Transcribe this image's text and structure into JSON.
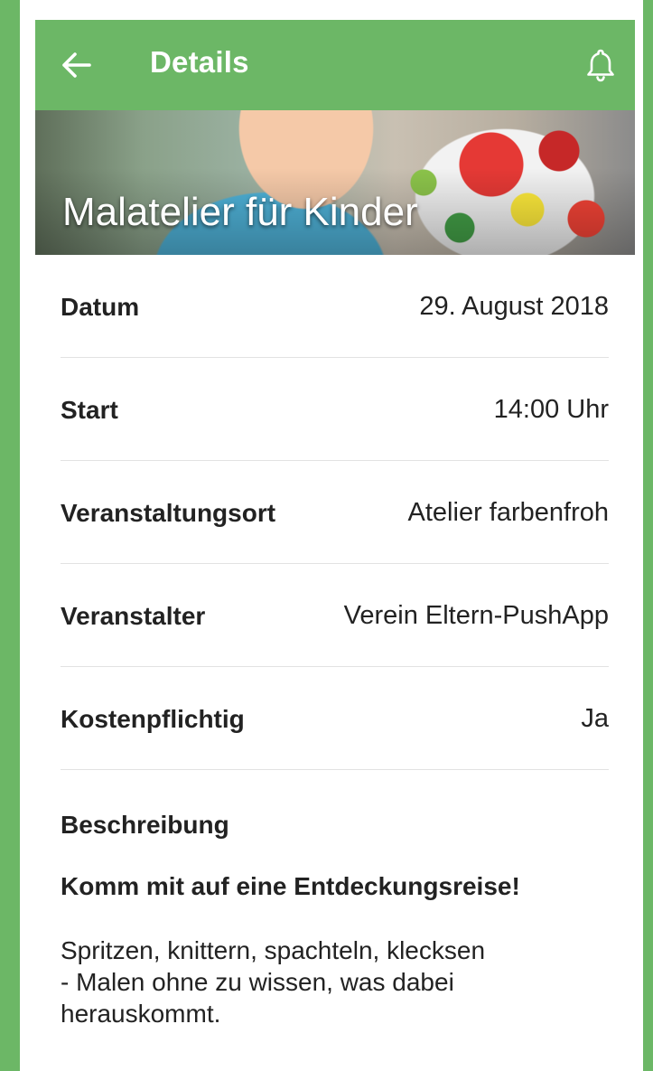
{
  "colors": {
    "accent": "#6cb766",
    "background": "#ffffff",
    "text": "#222222"
  },
  "appbar": {
    "title": "Details",
    "back_icon": "arrow-left-icon",
    "notification_icon": "bell-icon"
  },
  "event": {
    "title": "Malatelier für Kinder"
  },
  "details": [
    {
      "label": "Datum",
      "value": "29. August 2018"
    },
    {
      "label": "Start",
      "value": "14:00 Uhr"
    },
    {
      "label": "Veranstaltungsort",
      "value": "Atelier farbenfroh"
    },
    {
      "label": "Veranstalter",
      "value": "Verein Eltern-PushApp"
    },
    {
      "label": "Kostenpflichtig",
      "value": "Ja"
    }
  ],
  "description": {
    "heading": "Beschreibung",
    "subheading": "Komm mit auf eine Entdeckungsreise!",
    "text": "Spritzen, knittern, spachteln, klecksen\n- Malen ohne zu wissen, was dabei\nherauskommt."
  }
}
